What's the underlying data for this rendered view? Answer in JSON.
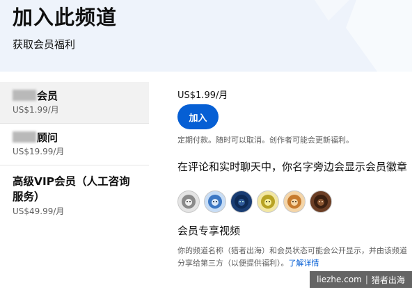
{
  "header": {
    "title": "加入此频道",
    "subtitle": "获取会员福利"
  },
  "tiers": [
    {
      "name_suffix": "会员",
      "price": "US$1.99/月",
      "selected": true
    },
    {
      "name_suffix": "顾问",
      "price": "US$19.99/月",
      "selected": false
    },
    {
      "name_line1": "高级VIP会员（人工咨询",
      "name_line2": "服务）",
      "price": "US$49.99/月",
      "selected": false
    }
  ],
  "main": {
    "price": "US$1.99/月",
    "join_label": "加入",
    "billing_note": "定期付款。随时可以取消。创作者可能会更新福利。",
    "perk_title": "在评论和实时聊天中，你名字旁边会显示会员徽章",
    "badges": [
      {
        "icon": "lion-badge-icon",
        "color": "#8a8a8a"
      },
      {
        "icon": "lion-badge-icon",
        "color": "#3d78c4"
      },
      {
        "icon": "lion-badge-icon",
        "color": "#0e2a55"
      },
      {
        "icon": "lion-badge-icon",
        "color": "#b8a324"
      },
      {
        "icon": "lion-badge-icon",
        "color": "#c77b2e"
      },
      {
        "icon": "lion-badge-icon",
        "color": "#3a1f10"
      }
    ],
    "section_title": "会员专享视频",
    "section_desc": "你的频道名称（猎者出海）和会员状态可能会公开显示，并由该频道分享给第三方（以便提供福利）。",
    "learn_more": "了解详情"
  },
  "watermark": {
    "site": "liezhe.com",
    "separator": "|",
    "brand": "猎者出海"
  },
  "colors": {
    "accent": "#065fd4",
    "header_bg": "#eef3fb",
    "selected_bg": "#f2f2f2"
  }
}
